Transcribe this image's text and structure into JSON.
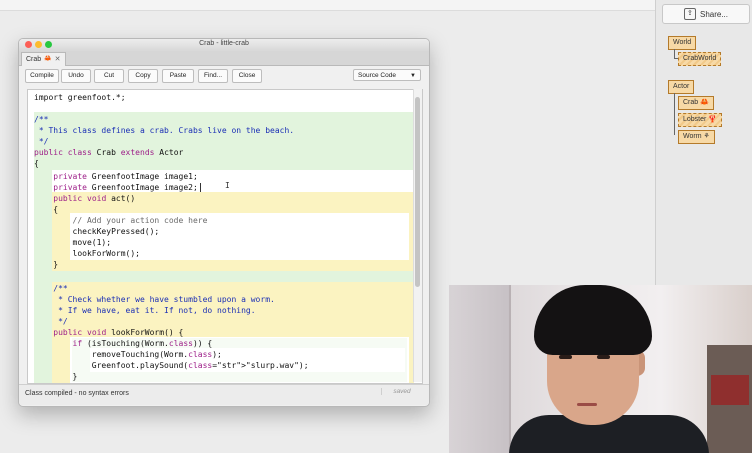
{
  "greenfoot": {
    "share_label": "Share...",
    "classes": {
      "world": "World",
      "crabworld": "CrabWorld",
      "actor": "Actor",
      "crab": "Crab",
      "lobster": "Lobster",
      "worm": "Worm"
    }
  },
  "editor": {
    "window_title": "Crab - little-crab",
    "tab_label": "Crab",
    "toolbar": {
      "compile": "Compile",
      "undo": "Undo",
      "cut": "Cut",
      "copy": "Copy",
      "paste": "Paste",
      "find": "Find...",
      "close": "Close",
      "view_select": "Source Code"
    },
    "code_lines": [
      "import greenfoot.*;",
      "/**",
      " * This class defines a crab. Crabs live on the beach.",
      " */",
      "public class Crab extends Actor",
      "{",
      "    private GreenfootImage image1;",
      "    private GreenfootImage image2;",
      "    public void act()",
      "    {",
      "        // Add your action code here",
      "        checkKeyPressed();",
      "        move(1);",
      "        lookForWorm();",
      "    }",
      "    /**",
      "     * Check whether we have stumbled upon a worm.",
      "     * If we have, eat it. If not, do nothing.",
      "     */",
      "    public void lookForWorm() {",
      "        if (isTouching(Worm.class)) {",
      "            removeTouching(Worm.class);",
      "            Greenfoot.playSound(\"slurp.wav\");",
      "        }"
    ],
    "status_text": "Class compiled - no syntax errors",
    "saved_label": "saved"
  },
  "colors": {
    "class_scope": "#e2f4dd",
    "method_scope": "#fbf3c1",
    "keyword": "#9d1e88",
    "comment": "#1b2fb5"
  }
}
